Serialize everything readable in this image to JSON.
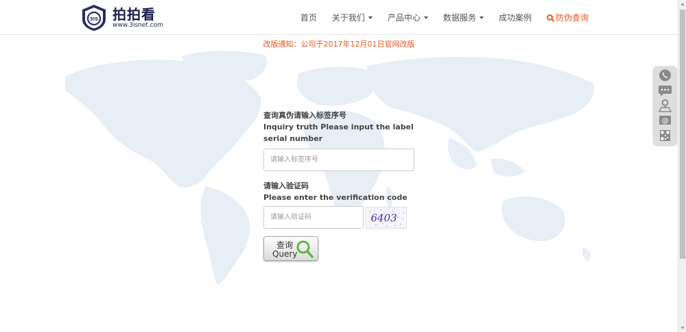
{
  "brand": {
    "name": "拍拍看",
    "url": "www.3isnet.com",
    "logo_initials": "3IS"
  },
  "nav": {
    "items": [
      {
        "label": "首页",
        "dropdown": false
      },
      {
        "label": "关于我们",
        "dropdown": true
      },
      {
        "label": "产品中心",
        "dropdown": true
      },
      {
        "label": "数据服务",
        "dropdown": true
      },
      {
        "label": "成功案例",
        "dropdown": false
      }
    ],
    "highlight": {
      "label": "防伪查询",
      "icon": "search-icon",
      "color": "#e8571e"
    }
  },
  "notice": {
    "text": "改版通知：公司于2017年12月01日官网改版",
    "color": "#e8571e"
  },
  "form": {
    "serial_label_cn": "查询真伪请输入标签序号",
    "serial_label_en": "Inquiry truth Please input the label serial number",
    "serial_input": {
      "value": "",
      "placeholder": "请输入标签序号"
    },
    "code_label_cn": "请输入验证码",
    "code_label_en": "Please enter the verification code",
    "code_input": {
      "value": "",
      "placeholder": "请输入验证码"
    },
    "captcha_text": "6403",
    "query_button": {
      "label_cn": "查询",
      "label_en": "Query"
    }
  },
  "sidebar": {
    "icons": [
      "phone-icon",
      "chat-icon",
      "location-icon",
      "email-icon",
      "qrcode-icon"
    ]
  },
  "colors": {
    "accent": "#e8571e",
    "brand": "#1d1d4d",
    "map": "#e8eef5"
  }
}
